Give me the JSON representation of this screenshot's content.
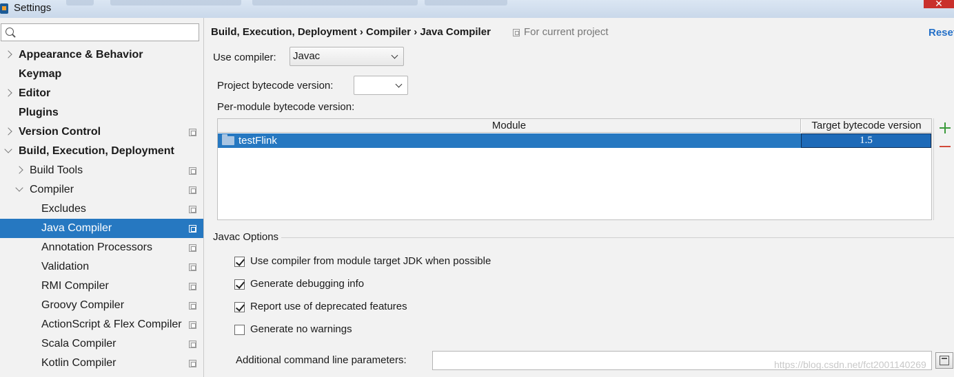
{
  "window": {
    "title": "Settings",
    "close_glyph": "✕"
  },
  "sidebar": {
    "search": {
      "placeholder": "",
      "value": ""
    },
    "items": [
      {
        "label": "Appearance & Behavior",
        "bold": true,
        "level": 0,
        "expander": "collapsed",
        "project_icon": false
      },
      {
        "label": "Keymap",
        "bold": true,
        "level": 0,
        "expander": "none",
        "project_icon": false
      },
      {
        "label": "Editor",
        "bold": true,
        "level": 0,
        "expander": "collapsed",
        "project_icon": false
      },
      {
        "label": "Plugins",
        "bold": true,
        "level": 0,
        "expander": "none",
        "project_icon": false
      },
      {
        "label": "Version Control",
        "bold": true,
        "level": 0,
        "expander": "collapsed",
        "project_icon": true
      },
      {
        "label": "Build, Execution, Deployment",
        "bold": true,
        "level": 0,
        "expander": "expanded",
        "project_icon": false
      },
      {
        "label": "Build Tools",
        "bold": false,
        "level": 1,
        "expander": "collapsed",
        "project_icon": true
      },
      {
        "label": "Compiler",
        "bold": false,
        "level": 1,
        "expander": "expanded",
        "project_icon": true
      },
      {
        "label": "Excludes",
        "bold": false,
        "level": 2,
        "expander": "none",
        "project_icon": true
      },
      {
        "label": "Java Compiler",
        "bold": false,
        "level": 2,
        "expander": "none",
        "project_icon": true,
        "selected": true
      },
      {
        "label": "Annotation Processors",
        "bold": false,
        "level": 2,
        "expander": "none",
        "project_icon": true
      },
      {
        "label": "Validation",
        "bold": false,
        "level": 2,
        "expander": "none",
        "project_icon": true
      },
      {
        "label": "RMI Compiler",
        "bold": false,
        "level": 2,
        "expander": "none",
        "project_icon": true
      },
      {
        "label": "Groovy Compiler",
        "bold": false,
        "level": 2,
        "expander": "none",
        "project_icon": true
      },
      {
        "label": "ActionScript & Flex Compiler",
        "bold": false,
        "level": 2,
        "expander": "none",
        "project_icon": true
      },
      {
        "label": "Scala Compiler",
        "bold": false,
        "level": 2,
        "expander": "none",
        "project_icon": true
      },
      {
        "label": "Kotlin Compiler",
        "bold": false,
        "level": 2,
        "expander": "none",
        "project_icon": true
      }
    ]
  },
  "main": {
    "breadcrumb": "Build, Execution, Deployment › Compiler › Java Compiler",
    "for_current_project": "For current project",
    "reset_label": "Reset",
    "use_compiler_label": "Use compiler:",
    "use_compiler_value": "Javac",
    "project_bytecode_label": "Project bytecode version:",
    "project_bytecode_value": "",
    "per_module_label": "Per-module bytecode version:",
    "table": {
      "columns": [
        "Module",
        "Target bytecode version"
      ],
      "rows": [
        {
          "module": "testFlink",
          "target": "1.5",
          "selected": true
        }
      ]
    },
    "javac_options_title": "Javac Options",
    "options": [
      {
        "label": "Use compiler from module target JDK when possible",
        "checked": true
      },
      {
        "label": "Generate debugging info",
        "checked": true
      },
      {
        "label": "Report use of deprecated features",
        "checked": true
      },
      {
        "label": "Generate no warnings",
        "checked": false
      }
    ],
    "additional_params_label": "Additional command line parameters:",
    "additional_params_value": "",
    "watermark": "https://blog.csdn.net/fct2001140269"
  },
  "colors": {
    "selection": "#2678c1",
    "link": "#2470c8",
    "add": "#3a9a3a",
    "remove": "#d24a3a"
  },
  "icons": {
    "search": "search-icon",
    "add": "plus-icon",
    "remove": "minus-icon",
    "module": "module-folder-icon",
    "expand": "expand-text-icon"
  }
}
